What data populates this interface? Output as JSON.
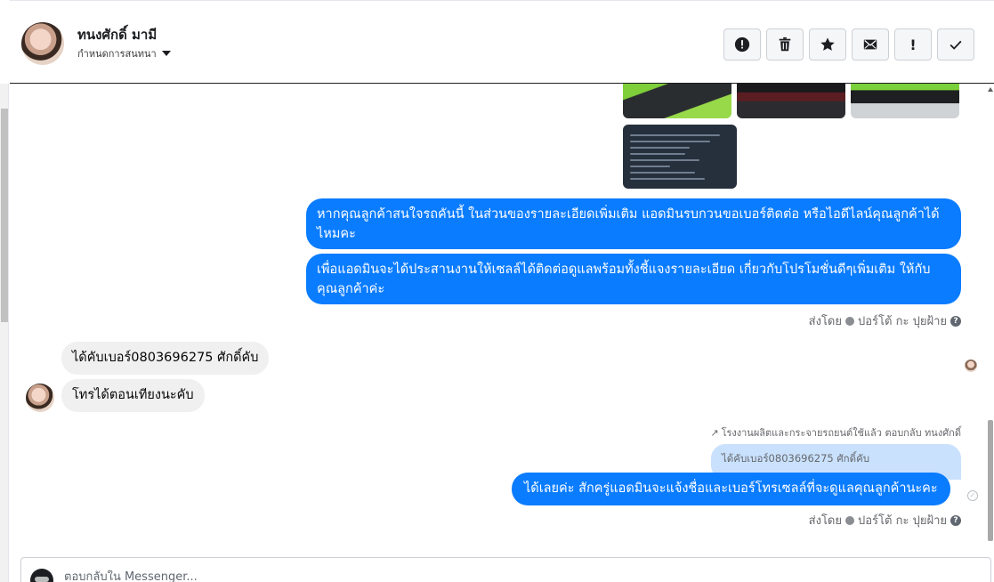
{
  "header": {
    "contact_name": "ทนงศักดิ์ มามี",
    "assign_label": "กำหนดการสนทนา"
  },
  "toolbar": {
    "buttons": [
      {
        "name": "report-spam-button",
        "icon": "alert-circle-icon"
      },
      {
        "name": "delete-button",
        "icon": "trash-icon"
      },
      {
        "name": "star-button",
        "icon": "star-icon"
      },
      {
        "name": "mark-unread-button",
        "icon": "envelope-icon"
      },
      {
        "name": "follow-up-button",
        "icon": "exclamation-icon",
        "glyph": "!"
      },
      {
        "name": "mark-done-button",
        "icon": "check-icon"
      }
    ]
  },
  "thread": {
    "messages_out": [
      "หากคุณลูกค้าสนใจรถคันนี้ ในส่วนของรายละเอียดเพิ่มเติม แอดมินรบกวนขอเบอร์ติดต่อ หรือไอดีไลน์คุณลูกค้าได้ไหมคะ",
      "เพื่อแอดมินจะได้ประสานงานให้เซลล์ได้ติดต่อดูแลพร้อมทั้งชี้แจงรายละเอียด เกี่ยวกับโปรโมชั่นดีๆเพิ่มเติม ให้กับคุณลูกค้าค่ะ"
    ],
    "sent_by_label": "ส่งโดย",
    "sent_by_name": "ปอร์โต้ กะ ปุยฝ้าย",
    "messages_in": [
      "ได้คับเบอร์0803696275 ศักดิ์คับ",
      "โทรได้ตอนเทียงนะคับ"
    ],
    "reply_meta": "โรงงานผลิตและกระจายรถยนต์ใช้แล้ว ตอบกลับ ทนงศักดิ์",
    "quoted_text": "ได้คับเบอร์0803696275 ศักดิ์คับ",
    "reply_message": "ได้เลยค่ะ สักครู่แอดมินจะแจ้งชื่อและเบอร์โทรเซลล์ที่จะดูแลคุณลูกค้านะคะ"
  },
  "composer": {
    "placeholder": "ตอบกลับใน Messenger..."
  }
}
